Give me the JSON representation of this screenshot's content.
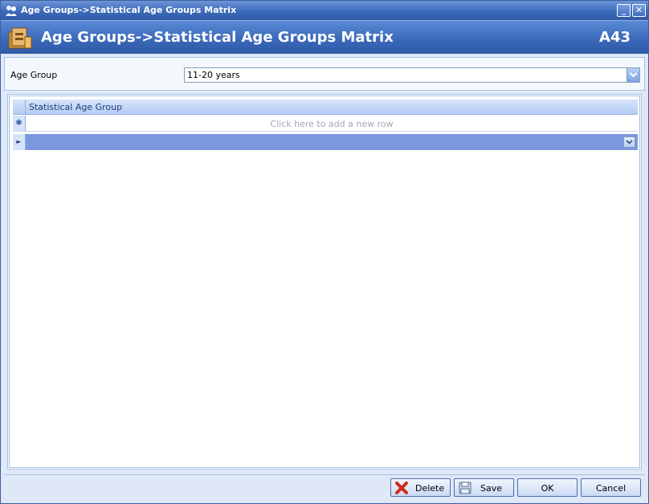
{
  "window": {
    "title": "Age Groups->Statistical Age Groups Matrix"
  },
  "header": {
    "title": "Age Groups->Statistical Age Groups Matrix",
    "code": "A43"
  },
  "form": {
    "age_group_label": "Age Group",
    "age_group_value": "11-20 years"
  },
  "grid": {
    "columns": [
      "Statistical Age Group"
    ],
    "new_row_hint": "Click here to add a new row",
    "new_row_marker": "✱",
    "current_row_marker": "►"
  },
  "footer": {
    "delete_label": "Delete",
    "save_label": "Save",
    "ok_label": "OK",
    "cancel_label": "Cancel"
  },
  "colors": {
    "titlebar": "#3c6ab9",
    "selected_row": "#7b97de",
    "window_bg": "#dfe8f6"
  }
}
